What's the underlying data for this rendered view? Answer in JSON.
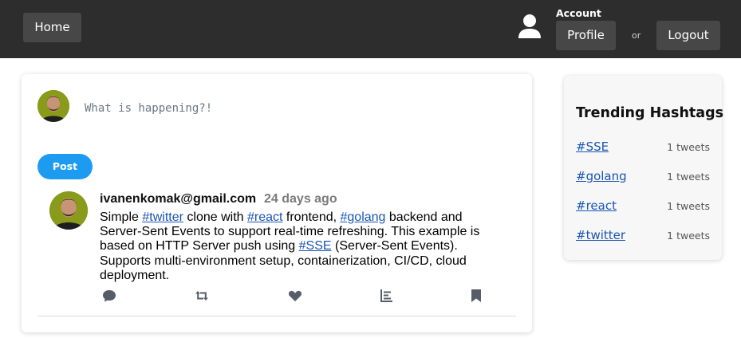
{
  "topbar": {
    "home_label": "Home",
    "account_label": "Account",
    "profile_label": "Profile",
    "or_label": "or",
    "logout_label": "Logout",
    "user_icon": "user-icon"
  },
  "composer": {
    "placeholder": "What is happening?!",
    "post_label": "Post"
  },
  "tweet": {
    "author": "ivanenkomak@gmail.com",
    "time": "24 days ago",
    "text_parts": {
      "p1": "Simple ",
      "h1": "#twitter",
      "p2": " clone with ",
      "h2": "#react",
      "p3": " frontend, ",
      "h3": "#golang",
      "p4": " backend and Server-Sent Events to support real-time refreshing. This example is based on HTTP Server push using ",
      "h4": "#SSE",
      "p5": " (Server-Sent Events). Supports multi-environment setup, containerization, CI/CD, cloud deployment."
    },
    "action_icons": [
      "comment-icon",
      "retweet-icon",
      "heart-icon",
      "stats-icon",
      "bookmark-icon"
    ]
  },
  "trending": {
    "title": "Trending Hashtags",
    "items": [
      {
        "tag": "#SSE",
        "count": "1 tweets"
      },
      {
        "tag": "#golang",
        "count": "1 tweets"
      },
      {
        "tag": "#react",
        "count": "1 tweets"
      },
      {
        "tag": "#twitter",
        "count": "1 tweets"
      }
    ]
  },
  "colors": {
    "topbar_bg": "#2d2d2d",
    "button_bg": "#474747",
    "post_blue": "#1d9bf0",
    "link_blue": "#1a55b3",
    "icon_gray": "#555e68"
  }
}
